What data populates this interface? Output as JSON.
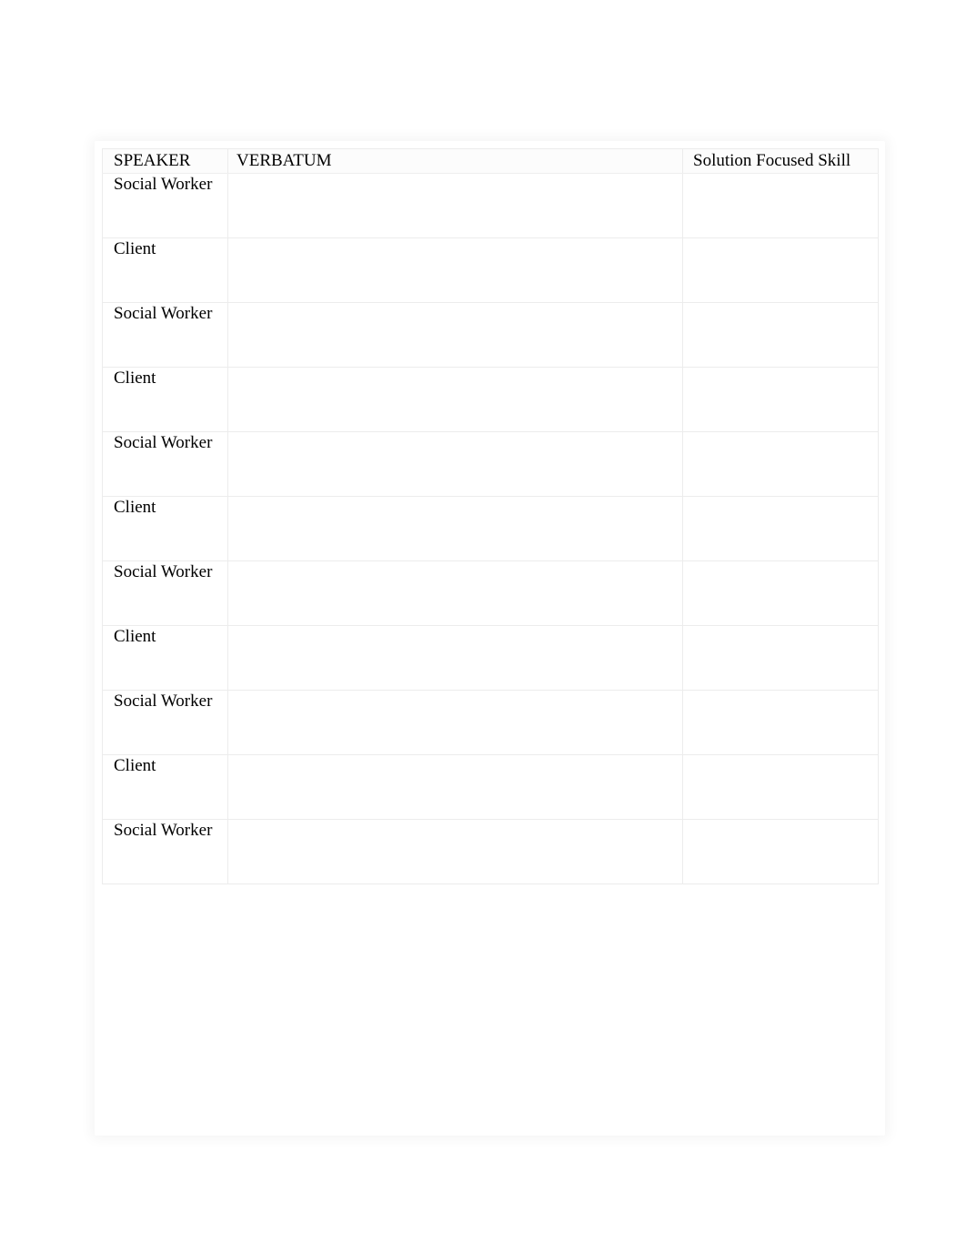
{
  "document": {
    "background_color": "#ffffff",
    "text_color": "#000000",
    "border_color": "#ececec"
  },
  "table": {
    "name": "solution-focused-transcript-table",
    "headers": {
      "speaker": "SPEAKER",
      "verbatum": "VERBATUM",
      "skill": "Solution Focused Skill"
    },
    "rows": [
      {
        "speaker": "Social Worker",
        "verbatum": "",
        "skill": ""
      },
      {
        "speaker": "Client",
        "verbatum": "",
        "skill": ""
      },
      {
        "speaker": "Social Worker",
        "verbatum": "",
        "skill": ""
      },
      {
        "speaker": "Client",
        "verbatum": "",
        "skill": ""
      },
      {
        "speaker": "Social Worker",
        "verbatum": "",
        "skill": ""
      },
      {
        "speaker": "Client",
        "verbatum": "",
        "skill": ""
      },
      {
        "speaker": "Social Worker",
        "verbatum": "",
        "skill": ""
      },
      {
        "speaker": "Client",
        "verbatum": "",
        "skill": ""
      },
      {
        "speaker": "Social Worker",
        "verbatum": "",
        "skill": ""
      },
      {
        "speaker": "Client",
        "verbatum": "",
        "skill": ""
      },
      {
        "speaker": "Social Worker",
        "verbatum": "",
        "skill": ""
      }
    ]
  }
}
